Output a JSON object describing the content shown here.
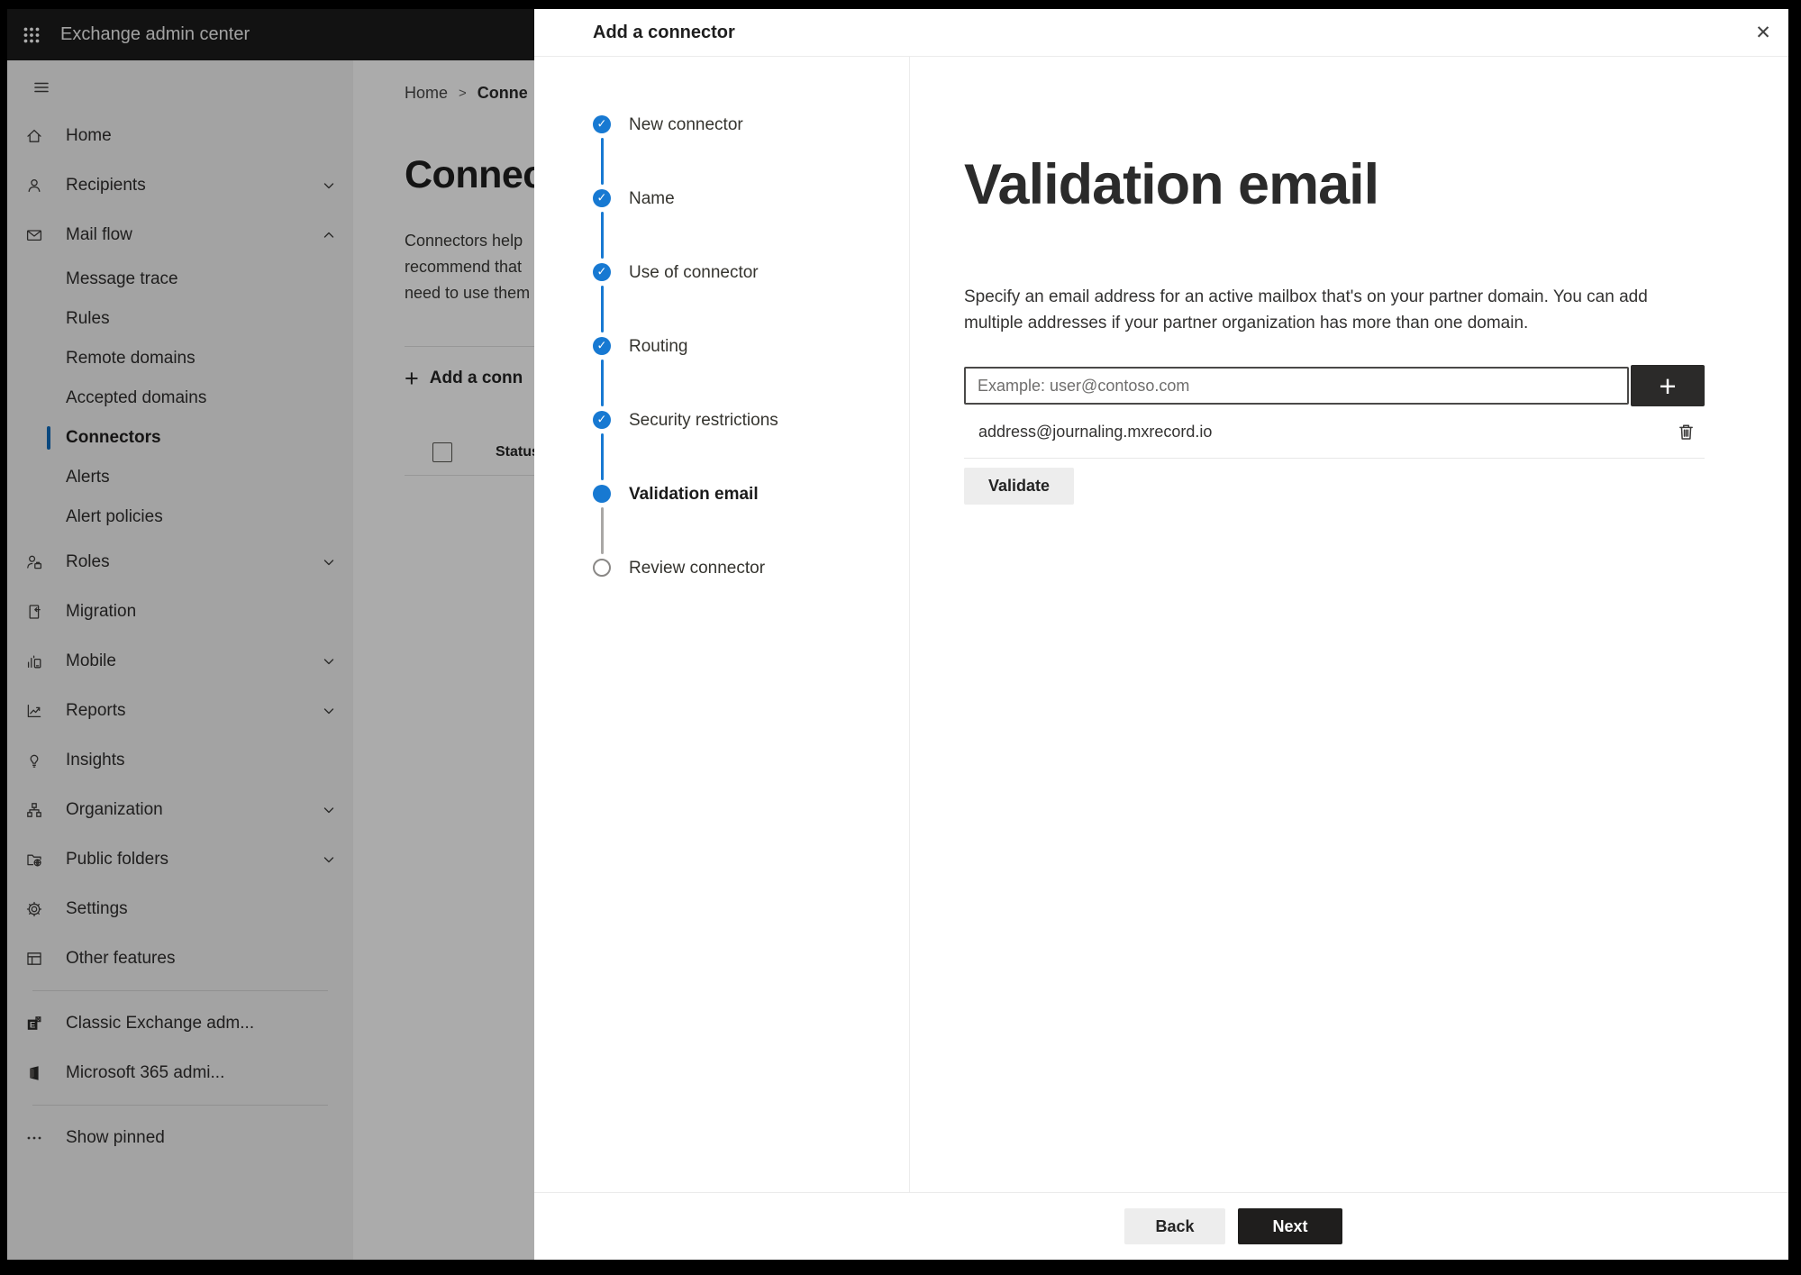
{
  "colors": {
    "accent": "#1779d2",
    "primary_button": "#1f1e1d",
    "selected_indicator": "#0f6cbd"
  },
  "topbar": {
    "app_launcher_icon": "apps-grid-icon",
    "title": "Exchange admin center"
  },
  "sidebar": {
    "menu_icon": "hamburger-icon",
    "items": [
      {
        "id": "home",
        "label": "Home",
        "icon": "home-icon"
      },
      {
        "id": "recipients",
        "label": "Recipients",
        "icon": "person-icon",
        "chevron": "down"
      },
      {
        "id": "mail-flow",
        "label": "Mail flow",
        "icon": "mail-icon",
        "chevron": "up"
      },
      {
        "id": "message-trace",
        "label": "Message trace",
        "sub": true
      },
      {
        "id": "rules",
        "label": "Rules",
        "sub": true
      },
      {
        "id": "remote-domains",
        "label": "Remote domains",
        "sub": true
      },
      {
        "id": "accepted-domains",
        "label": "Accepted domains",
        "sub": true
      },
      {
        "id": "connectors",
        "label": "Connectors",
        "sub": true,
        "selected": true
      },
      {
        "id": "alerts",
        "label": "Alerts",
        "sub": true
      },
      {
        "id": "alert-policies",
        "label": "Alert policies",
        "sub": true
      },
      {
        "id": "roles",
        "label": "Roles",
        "icon": "roles-icon",
        "chevron": "down"
      },
      {
        "id": "migration",
        "label": "Migration",
        "icon": "migration-icon"
      },
      {
        "id": "mobile",
        "label": "Mobile",
        "icon": "mobile-icon",
        "chevron": "down"
      },
      {
        "id": "reports",
        "label": "Reports",
        "icon": "reports-icon",
        "chevron": "down"
      },
      {
        "id": "insights",
        "label": "Insights",
        "icon": "insights-icon"
      },
      {
        "id": "organization",
        "label": "Organization",
        "icon": "organization-icon",
        "chevron": "down"
      },
      {
        "id": "public-folders",
        "label": "Public folders",
        "icon": "public-folders-icon",
        "chevron": "down"
      },
      {
        "id": "settings",
        "label": "Settings",
        "icon": "settings-icon"
      },
      {
        "id": "other-features",
        "label": "Other features",
        "icon": "other-features-icon"
      },
      {
        "divider": true
      },
      {
        "id": "classic-exchange",
        "label": "Classic Exchange adm...",
        "icon": "classic-exchange-icon"
      },
      {
        "id": "microsoft-365",
        "label": "Microsoft 365 admi...",
        "icon": "microsoft-365-icon"
      },
      {
        "divider": true
      },
      {
        "id": "show-pinned",
        "label": "Show pinned",
        "icon": "ellipsis-icon"
      }
    ]
  },
  "page": {
    "breadcrumb": {
      "home": "Home",
      "separator": ">",
      "current": "Conne"
    },
    "title": "Connec",
    "intro_lines": [
      "Connectors help",
      "recommend that",
      "need to use them"
    ],
    "add_connector_plus": "+",
    "add_connector_button": "Add a conn",
    "status_column": "Status"
  },
  "modal": {
    "title": "Add a connector",
    "close_icon": "✕",
    "steps": [
      {
        "label": "New connector",
        "state": "completed"
      },
      {
        "label": "Name",
        "state": "completed"
      },
      {
        "label": "Use of connector",
        "state": "completed"
      },
      {
        "label": "Routing",
        "state": "completed"
      },
      {
        "label": "Security restrictions",
        "state": "completed"
      },
      {
        "label": "Validation email",
        "state": "current"
      },
      {
        "label": "Review connector",
        "state": "upcoming"
      }
    ],
    "pane": {
      "heading": "Validation email",
      "description": "Specify an email address for an active mailbox that's on your partner domain. You can add multiple addresses if your partner organization has more than one domain.",
      "email_input": {
        "value": "",
        "placeholder": "Example: user@contoso.com"
      },
      "add_button": "+",
      "addresses": [
        {
          "email": "address@journaling.mxrecord.io"
        }
      ],
      "validate_button": "Validate"
    },
    "footer": {
      "back_button": "Back",
      "next_button": "Next"
    }
  }
}
